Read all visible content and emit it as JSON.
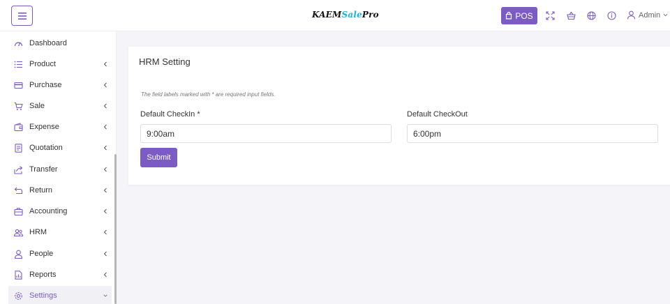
{
  "header": {
    "brand_part1": "KAEM",
    "brand_part2": "Sale",
    "brand_part3": "Pro",
    "pos_label": "POS",
    "admin_label": "Admin",
    "icons": [
      "menu-icon",
      "fullscreen-icon",
      "basket-icon",
      "globe-icon",
      "info-icon",
      "user-icon"
    ]
  },
  "sidebar": {
    "items": [
      {
        "label": "Dashboard",
        "icon": "dashboard-icon",
        "chevron": false
      },
      {
        "label": "Product",
        "icon": "list-icon",
        "chevron": true
      },
      {
        "label": "Purchase",
        "icon": "credit-card-icon",
        "chevron": true
      },
      {
        "label": "Sale",
        "icon": "cart-icon",
        "chevron": true
      },
      {
        "label": "Expense",
        "icon": "wallet-icon",
        "chevron": true
      },
      {
        "label": "Quotation",
        "icon": "document-icon",
        "chevron": true
      },
      {
        "label": "Transfer",
        "icon": "share-icon",
        "chevron": true
      },
      {
        "label": "Return",
        "icon": "return-icon",
        "chevron": true
      },
      {
        "label": "Accounting",
        "icon": "briefcase-icon",
        "chevron": true
      },
      {
        "label": "HRM",
        "icon": "team-icon",
        "chevron": true
      },
      {
        "label": "People",
        "icon": "person-icon",
        "chevron": true
      },
      {
        "label": "Reports",
        "icon": "report-icon",
        "chevron": true
      },
      {
        "label": "Settings",
        "icon": "gear-icon",
        "chevron": true,
        "active": true
      }
    ]
  },
  "main": {
    "title": "HRM Setting",
    "note": "The field labels marked with * are required input fields.",
    "checkin_label": "Default CheckIn *",
    "checkin_value": "9:00am",
    "checkout_label": "Default CheckOut",
    "checkout_value": "6:00pm",
    "submit_label": "Submit"
  },
  "colors": {
    "accent": "#7c5cc4",
    "brand_highlight": "#1bb1dc",
    "background": "#f4f4f9"
  }
}
